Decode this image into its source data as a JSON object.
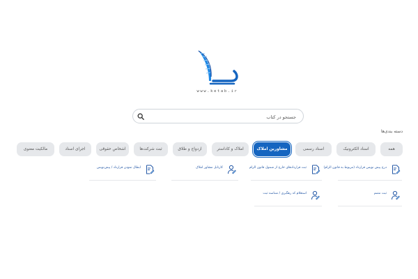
{
  "logo": {
    "url_text": "www.ketab.ir",
    "icon": "quill-book-icon"
  },
  "search": {
    "placeholder": "جستجو در کتاب",
    "value": "",
    "icon": "search-icon"
  },
  "categories": {
    "title": "دسته بندی‌ها",
    "tabs": [
      {
        "label": "همه",
        "active": false
      },
      {
        "label": "اسناد الکترونیک",
        "active": false
      },
      {
        "label": "اسناد رسمی",
        "active": false
      },
      {
        "label": "مشاورین املاک",
        "active": true
      },
      {
        "label": "املاک و کاداستر",
        "active": false
      },
      {
        "label": "ازدواج و طلاق",
        "active": false
      },
      {
        "label": "ثبت شرکت‌ها",
        "active": false
      },
      {
        "label": "اشخاص حقوقی",
        "active": false
      },
      {
        "label": "اجرای اسناد",
        "active": false
      },
      {
        "label": "مالکیت معنوی",
        "active": false
      }
    ]
  },
  "services": [
    {
      "label": "درج پیش نویس قرارداد (مربوط به قانون الزام)",
      "icon": "document-edit-icon"
    },
    {
      "label": "ثبت قرارداد‌های خارج از شمول قانون الزام",
      "icon": "document-edit-icon"
    },
    {
      "label": "کارتابل مشاور املاک",
      "icon": "user-edit-icon"
    },
    {
      "label": "ابطال نمودن قرارداد / پیش‌نویس",
      "icon": "document-edit-icon"
    },
    {
      "label": "ثبت متمم",
      "icon": "user-edit-icon"
    },
    {
      "label": "استعلام کد رهگیری / شناسه ثبت",
      "icon": "user-edit-icon"
    }
  ],
  "colors": {
    "primary": "#1565c0",
    "tab_bg": "#e6e8eb",
    "link": "#2458a6"
  }
}
